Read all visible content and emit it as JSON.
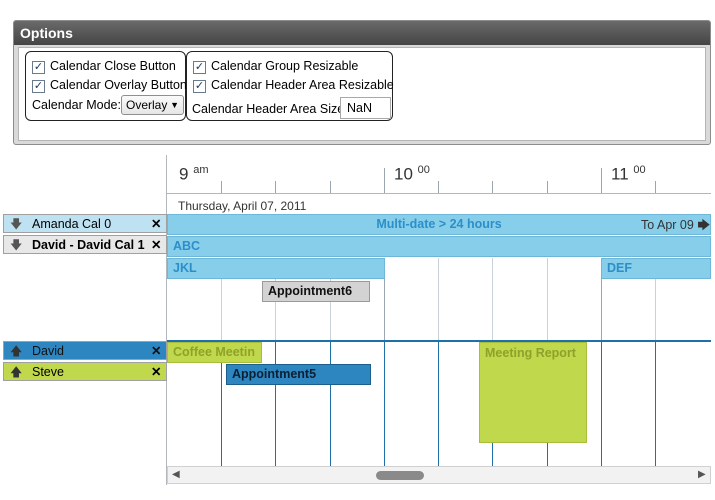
{
  "options": {
    "title": "Options",
    "close_button_label": "Calendar Close Button",
    "overlay_button_label": "Calendar Overlay Button",
    "mode_label": "Calendar Mode:",
    "mode_value": "Overlay",
    "group_resizable_label": "Calendar Group Resizable",
    "header_resizable_label": "Calendar Header Area Resizable",
    "header_size_label": "Calendar Header Area Size",
    "header_size_value": "NaN"
  },
  "timeline": {
    "hours": [
      {
        "h": "9",
        "suffix": "am"
      },
      {
        "h": "10",
        "suffix": "00"
      },
      {
        "h": "11",
        "suffix": "00"
      }
    ],
    "date": "Thursday, April 07, 2011"
  },
  "groups": [
    {
      "calendars": [
        {
          "name": "Amanda Cal 0",
          "bold": false,
          "close": "✕"
        },
        {
          "name": "David - David Cal 1",
          "bold": true,
          "close": "✕"
        }
      ]
    },
    {
      "calendars": [
        {
          "name": "David",
          "close": "✕"
        },
        {
          "name": "Steve",
          "close": "✕"
        }
      ]
    }
  ],
  "events": {
    "multi_date": "Multi-date > 24 hours",
    "multi_date_to": "To Apr 09",
    "abc": "ABC",
    "jkl": "JKL",
    "def": "DEF",
    "appointment6": "Appointment6",
    "coffee": "Coffee Meetin",
    "appointment5": "Appointment5",
    "meeting_report": "Meeting Report"
  },
  "colors": {
    "light_blue": "#87ceeb",
    "dark_blue": "#2e86c1",
    "lime": "#c0d84b",
    "gray_event": "#d3d3d3"
  }
}
